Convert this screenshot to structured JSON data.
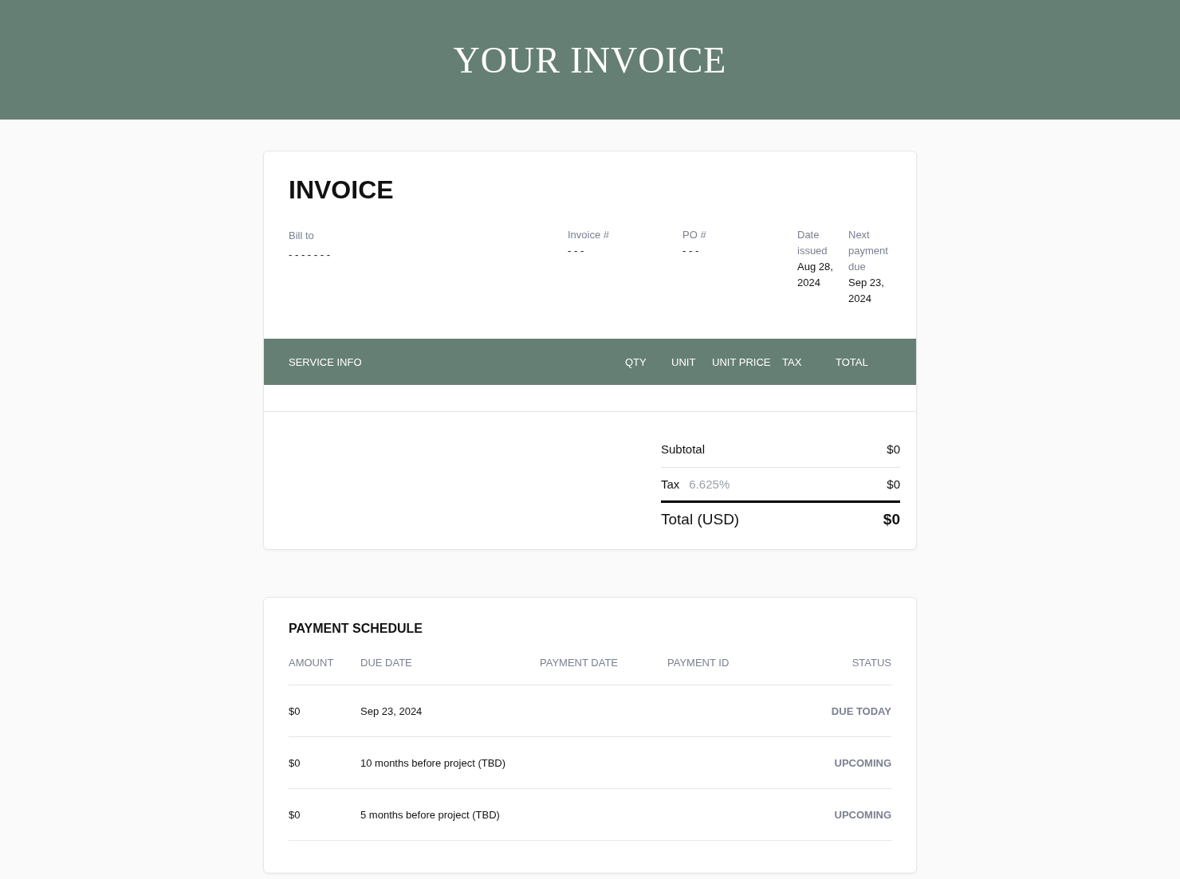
{
  "banner": {
    "title": "YOUR INVOICE"
  },
  "invoice": {
    "heading": "INVOICE",
    "meta": [
      {
        "label": "Bill to",
        "value": "- - - - - - -"
      },
      {
        "label": "Invoice #",
        "value": "- - -"
      },
      {
        "label": "PO #",
        "value": "- - -"
      },
      {
        "label": "Date issued",
        "value": "Aug 28, 2024"
      },
      {
        "label": "Next payment due",
        "value": "Sep 23, 2024"
      }
    ],
    "table": {
      "columns": [
        "SERVICE INFO",
        "QTY",
        "UNIT",
        "UNIT PRICE",
        "TAX",
        "TOTAL"
      ]
    },
    "totals": {
      "subtotal_label": "Subtotal",
      "subtotal": "$0",
      "tax_label": "Tax",
      "tax_rate_placeholder": "6.625%",
      "tax": "$0",
      "total_label": "Total (USD)",
      "total": "$0"
    }
  },
  "payment_schedule": {
    "heading": "PAYMENT SCHEDULE",
    "columns": [
      "AMOUNT",
      "DUE DATE",
      "PAYMENT DATE",
      "PAYMENT ID",
      "STATUS"
    ],
    "rows": [
      {
        "amount": "$0",
        "due_date": "Sep 23, 2024",
        "status": "DUE TODAY"
      },
      {
        "amount": "$0",
        "due_date": "10 months before project (TBD)",
        "status": "UPCOMING"
      },
      {
        "amount": "$0",
        "due_date": "5 months before project (TBD)",
        "status": "UPCOMING"
      }
    ]
  }
}
